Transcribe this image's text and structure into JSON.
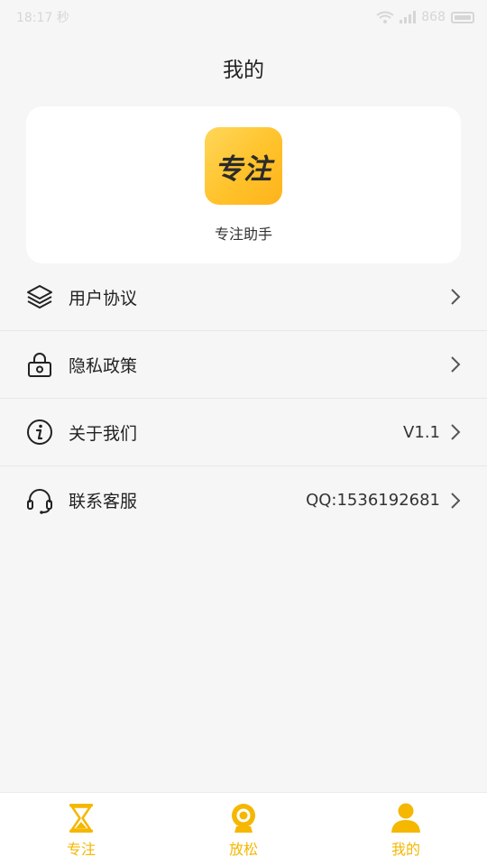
{
  "status_bar": {
    "time": "18:17",
    "extra": "秒",
    "network_text": "868"
  },
  "header": {
    "title": "我的"
  },
  "profile": {
    "logo_text": "专注",
    "app_name": "专注助手"
  },
  "menu": {
    "items": [
      {
        "label": "用户协议",
        "value": "",
        "icon": "layers-icon"
      },
      {
        "label": "隐私政策",
        "value": "",
        "icon": "lock-icon"
      },
      {
        "label": "关于我们",
        "value": "V1.1",
        "icon": "info-icon"
      },
      {
        "label": "联系客服",
        "value": "QQ:1536192681",
        "icon": "headset-icon"
      }
    ]
  },
  "tabs": [
    {
      "label": "专注",
      "icon": "hourglass-icon"
    },
    {
      "label": "放松",
      "icon": "camera-icon"
    },
    {
      "label": "我的",
      "icon": "user-icon"
    }
  ],
  "colors": {
    "accent": "#f5b700",
    "logo_bg": "#ffc22a",
    "background": "#f6f6f6"
  }
}
